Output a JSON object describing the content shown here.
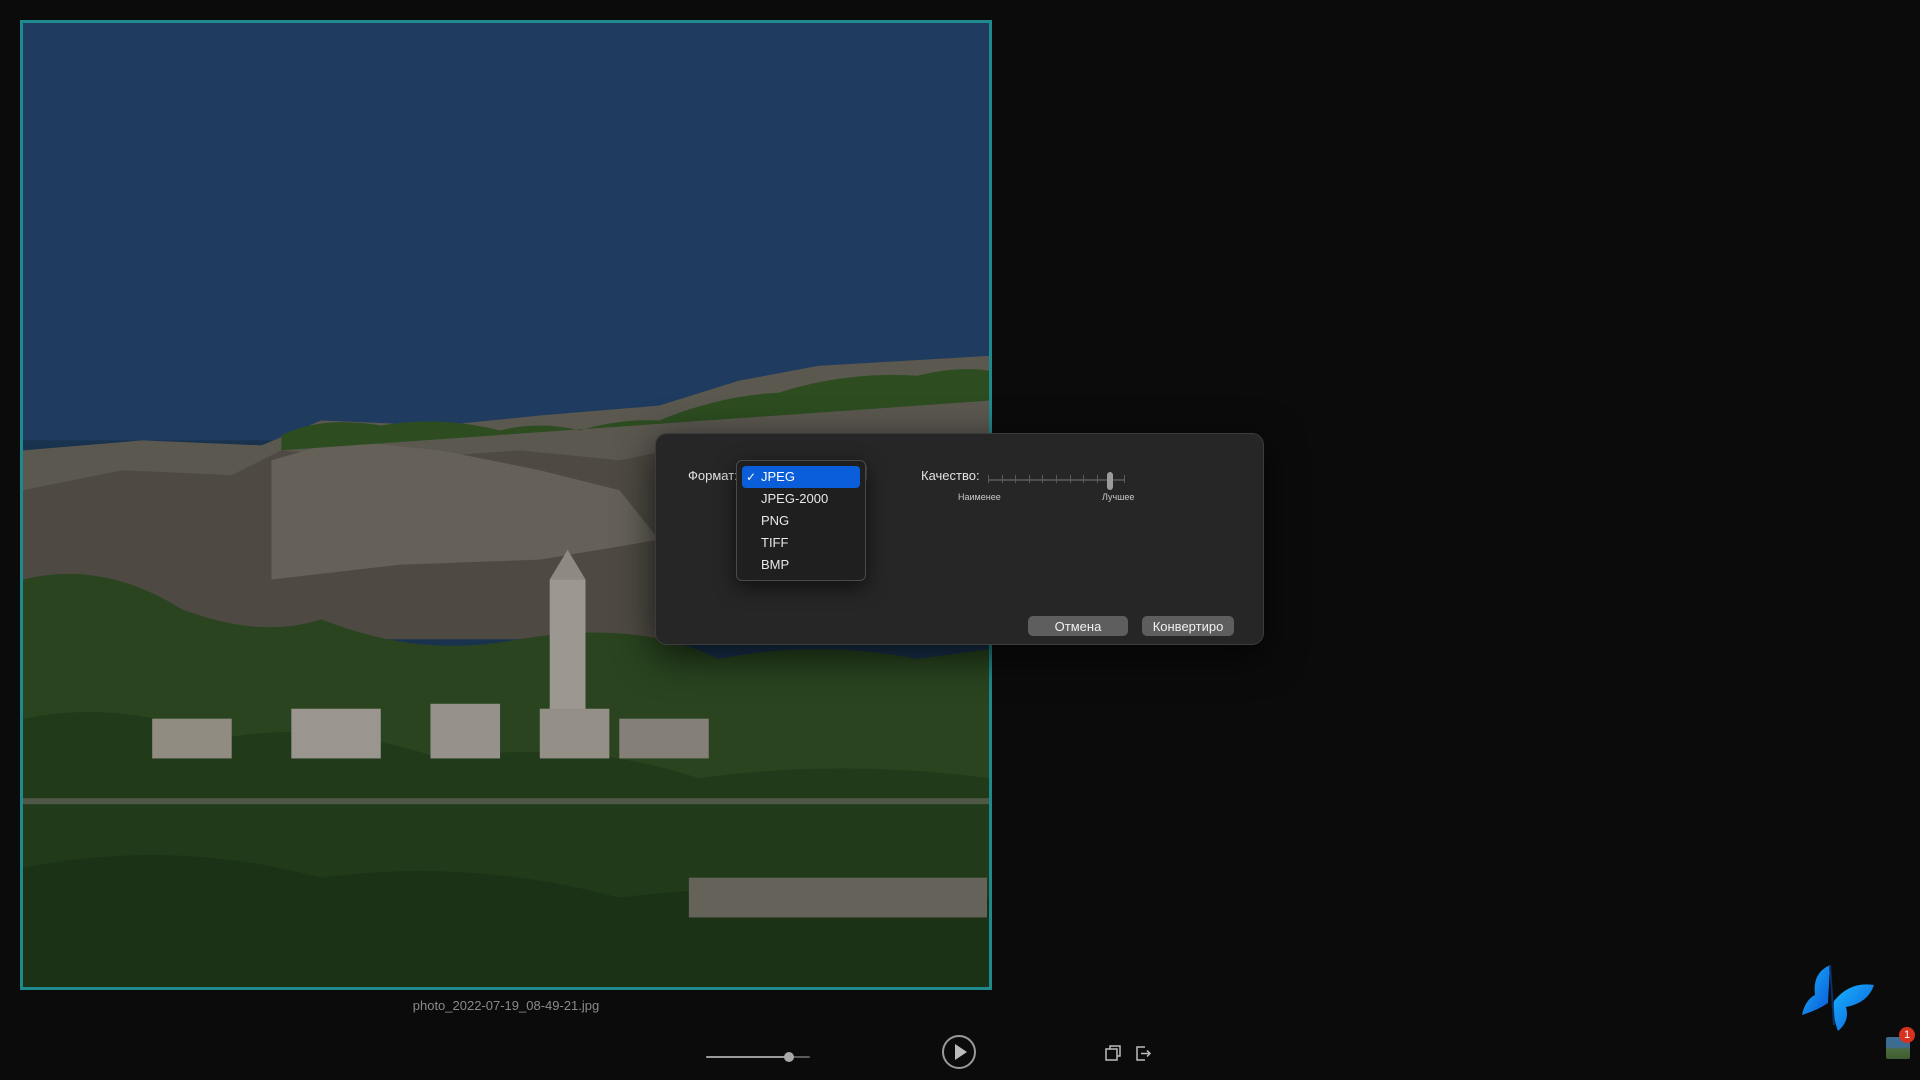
{
  "viewer": {
    "filename": "photo_2022-07-19_08-49-21.jpg",
    "zoom_level": 0.8
  },
  "dialog": {
    "format_label": "Формат:",
    "quality_label": "Качество:",
    "quality_min_label": "Наименее",
    "quality_max_label": "Лучшее",
    "quality_value": 0.9,
    "cancel_label": "Отмена",
    "convert_label": "Конвертиро",
    "format_options": [
      {
        "label": "JPEG",
        "checked": true
      },
      {
        "label": "JPEG-2000",
        "checked": false
      },
      {
        "label": "PNG",
        "checked": false
      },
      {
        "label": "TIFF",
        "checked": false
      },
      {
        "label": "BMP",
        "checked": false
      }
    ],
    "check_mark": "✓"
  },
  "dock": {
    "badge_count": "1"
  },
  "colors": {
    "accent": "#0b5ed9",
    "frame": "#1f8a8e",
    "dialog_bg": "#262626"
  },
  "icons": {
    "play": "play-icon",
    "window": "window-icon",
    "share": "share-icon",
    "butterfly": "butterfly-icon"
  }
}
